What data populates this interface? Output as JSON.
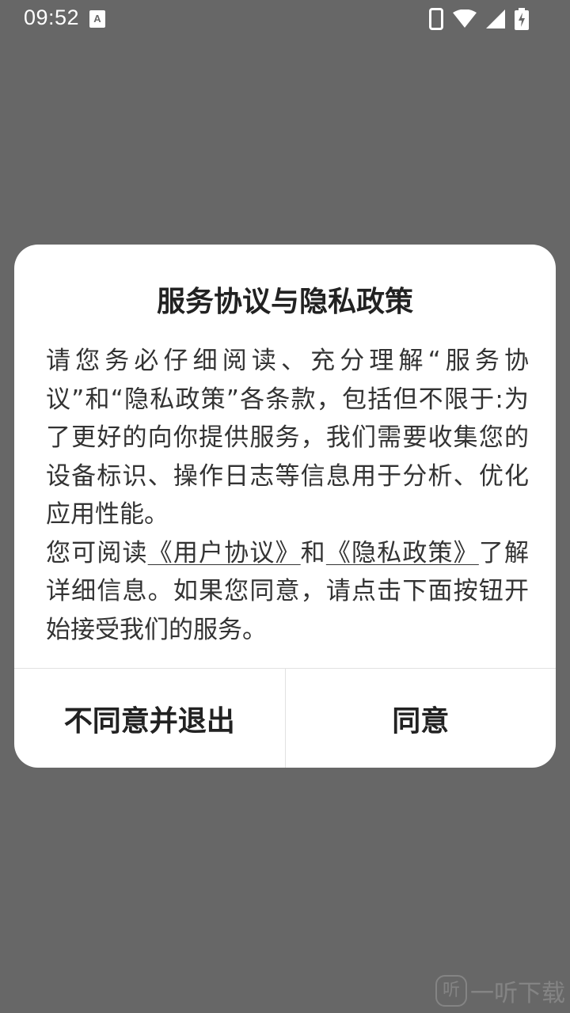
{
  "status_bar": {
    "time": "09:52",
    "notification_icon_letter": "A",
    "icons": [
      "phone-icon",
      "wifi-icon",
      "signal-icon",
      "battery-charging-icon"
    ]
  },
  "dialog": {
    "title": "服务协议与隐私政策",
    "body_intro": "请您务必仔细阅读、充分理解“服务协议”和“隐私政策”各条款，包括但不限于:为了更好的向你提供服务，我们需要收集您的设备标识、操作日志等信息用于分析、优化应用性能。",
    "body_read": "您可阅读",
    "user_agreement_link": "《用户协议》",
    "and": "和",
    "privacy_policy_link": "《隐私政策》",
    "body_outro": "了解详细信息。如果您同意，请点击下面按钮开始接受我们的服务。",
    "disagree_button": "不同意并退出",
    "agree_button": "同意"
  },
  "watermark": {
    "icon_char": "听",
    "text": "一听下载"
  },
  "colors": {
    "background": "#676767",
    "dialog": "#ffffff",
    "text": "#333333"
  }
}
